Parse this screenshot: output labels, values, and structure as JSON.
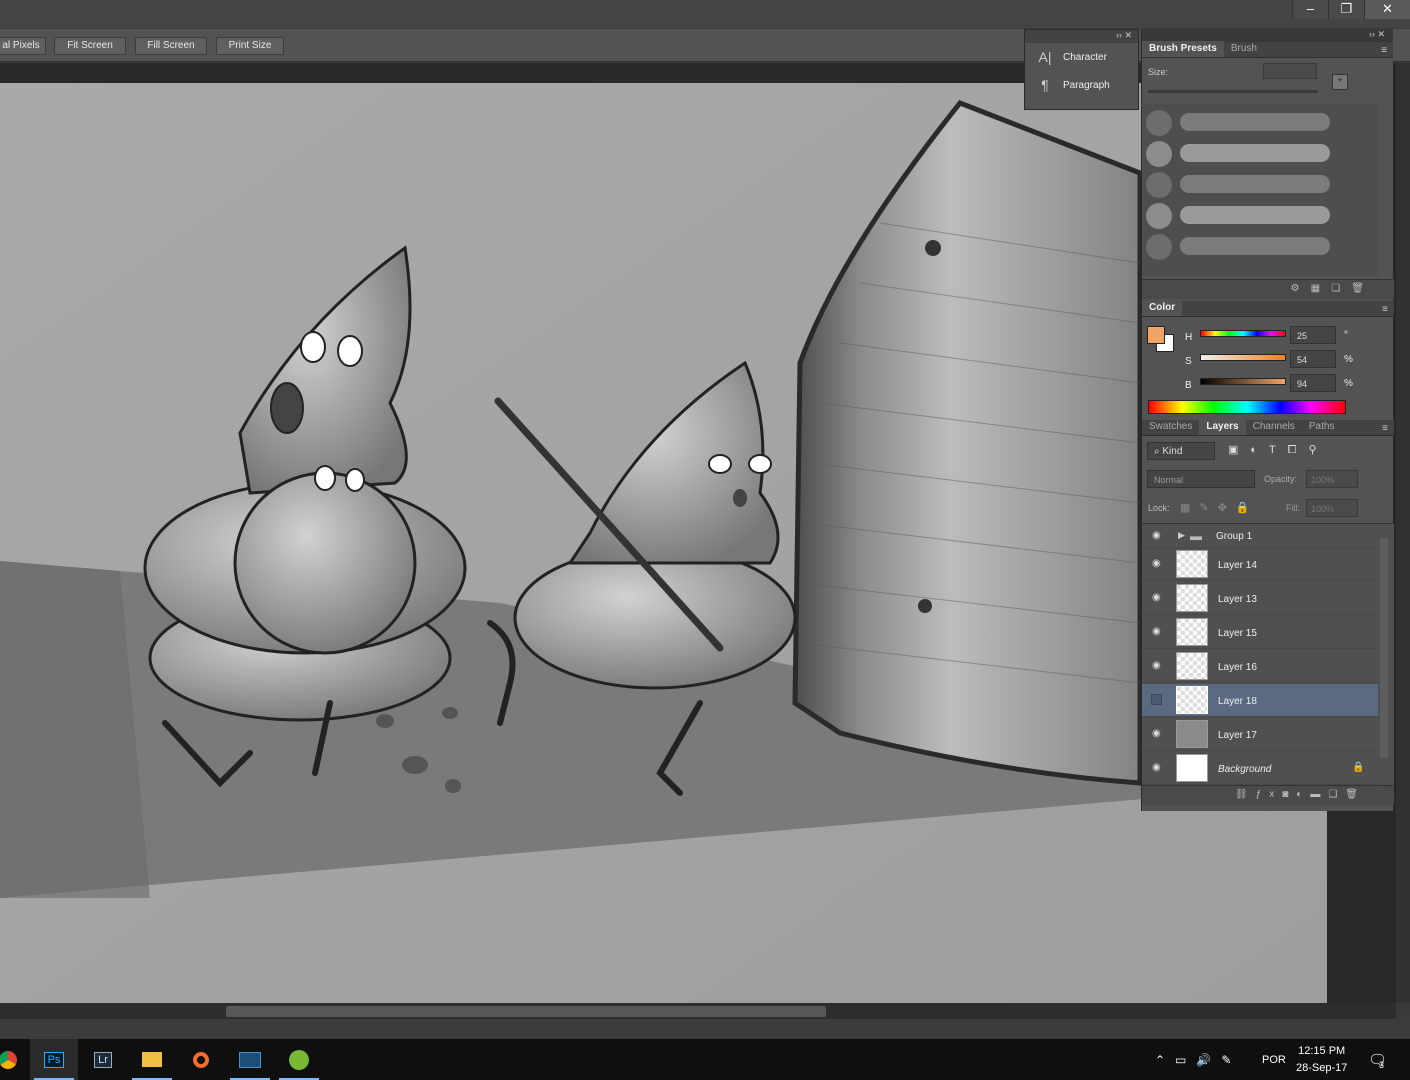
{
  "window": {
    "minimize": "–",
    "restore": "❐",
    "close": "✕"
  },
  "options_bar": {
    "buttons": [
      "al Pixels",
      "Fit Screen",
      "Fill Screen",
      "Print Size"
    ]
  },
  "char_panel": {
    "items": [
      {
        "icon": "A|",
        "label": "Character"
      },
      {
        "icon": "¶",
        "label": "Paragraph"
      }
    ]
  },
  "brush_panel": {
    "tabs": [
      "Brush Presets",
      "Brush"
    ],
    "size_label": "Size:"
  },
  "color_panel": {
    "tab": "Color",
    "foreground": "#f0a468",
    "background": "#ffffff",
    "h": {
      "label": "H",
      "value": "25",
      "unit": "°"
    },
    "s": {
      "label": "S",
      "value": "54",
      "unit": "%"
    },
    "b": {
      "label": "B",
      "value": "94",
      "unit": "%"
    }
  },
  "layers_panel": {
    "tabs": [
      "Swatches",
      "Layers",
      "Channels",
      "Paths"
    ],
    "filter": "Kind",
    "blend_mode": "Normal",
    "opacity_label": "Opacity:",
    "opacity": "100%",
    "lock_label": "Lock:",
    "fill_label": "Fill:",
    "fill": "100%",
    "layers": [
      {
        "name": "Group 1",
        "type": "group",
        "visible": true
      },
      {
        "name": "Layer 14",
        "visible": true
      },
      {
        "name": "Layer 13",
        "visible": true
      },
      {
        "name": "Layer 15",
        "visible": true
      },
      {
        "name": "Layer 16",
        "visible": true
      },
      {
        "name": "Layer 18",
        "visible": false,
        "selected": true
      },
      {
        "name": "Layer 17",
        "visible": true
      },
      {
        "name": "Background",
        "visible": true,
        "locked": true
      }
    ]
  },
  "taskbar": {
    "apps": [
      "chrome",
      "Ps",
      "Lr",
      "file-explorer",
      "origin",
      "monitor",
      "utorrent"
    ],
    "language": "POR",
    "time": "12:15 PM",
    "date": "28-Sep-17",
    "notifications": "3"
  }
}
